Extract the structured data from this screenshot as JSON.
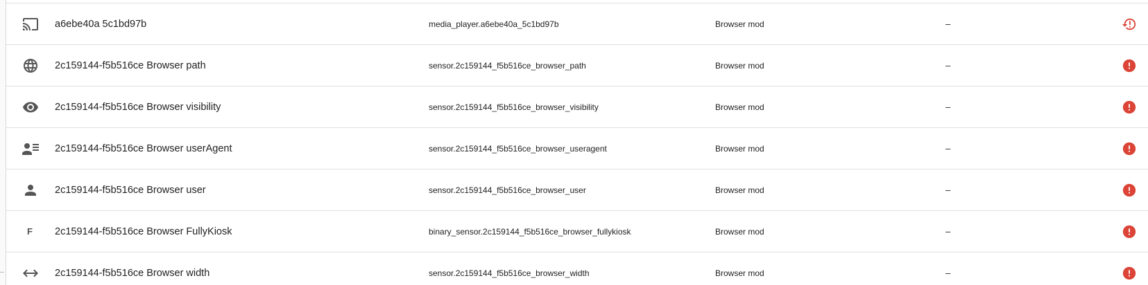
{
  "entities_table": {
    "rows": [
      {
        "icon": "cast-icon",
        "name": "a6ebe40a 5c1bd97b",
        "entity_id": "media_player.a6ebe40a_5c1bd97b",
        "integration": "Browser mod",
        "area": "–",
        "status": "restore-alert-icon"
      },
      {
        "icon": "globe-icon",
        "name": "2c159144-f5b516ce Browser path",
        "entity_id": "sensor.2c159144_f5b516ce_browser_path",
        "integration": "Browser mod",
        "area": "–",
        "status": "alert-circle-icon"
      },
      {
        "icon": "eye-icon",
        "name": "2c159144-f5b516ce Browser visibility",
        "entity_id": "sensor.2c159144_f5b516ce_browser_visibility",
        "integration": "Browser mod",
        "area": "–",
        "status": "alert-circle-icon"
      },
      {
        "icon": "account-details-icon",
        "name": "2c159144-f5b516ce Browser userAgent",
        "entity_id": "sensor.2c159144_f5b516ce_browser_useragent",
        "integration": "Browser mod",
        "area": "–",
        "status": "alert-circle-icon"
      },
      {
        "icon": "account-icon",
        "name": "2c159144-f5b516ce Browser user",
        "entity_id": "sensor.2c159144_f5b516ce_browser_user",
        "integration": "Browser mod",
        "area": "–",
        "status": "alert-circle-icon"
      },
      {
        "icon": "letter-f-icon",
        "icon_text": "F",
        "name": "2c159144-f5b516ce Browser FullyKiosk",
        "entity_id": "binary_sensor.2c159144_f5b516ce_browser_fullykiosk",
        "integration": "Browser mod",
        "area": "–",
        "status": "alert-circle-icon"
      },
      {
        "icon": "arrow-left-right-icon",
        "name": "2c159144-f5b516ce Browser width",
        "entity_id": "sensor.2c159144_f5b516ce_browser_width",
        "integration": "Browser mod",
        "area": "–",
        "status": "alert-circle-icon"
      }
    ]
  },
  "colors": {
    "icon": "#555555",
    "text": "#212121",
    "divider": "#e0e0e0",
    "status_red": "#db4437"
  }
}
